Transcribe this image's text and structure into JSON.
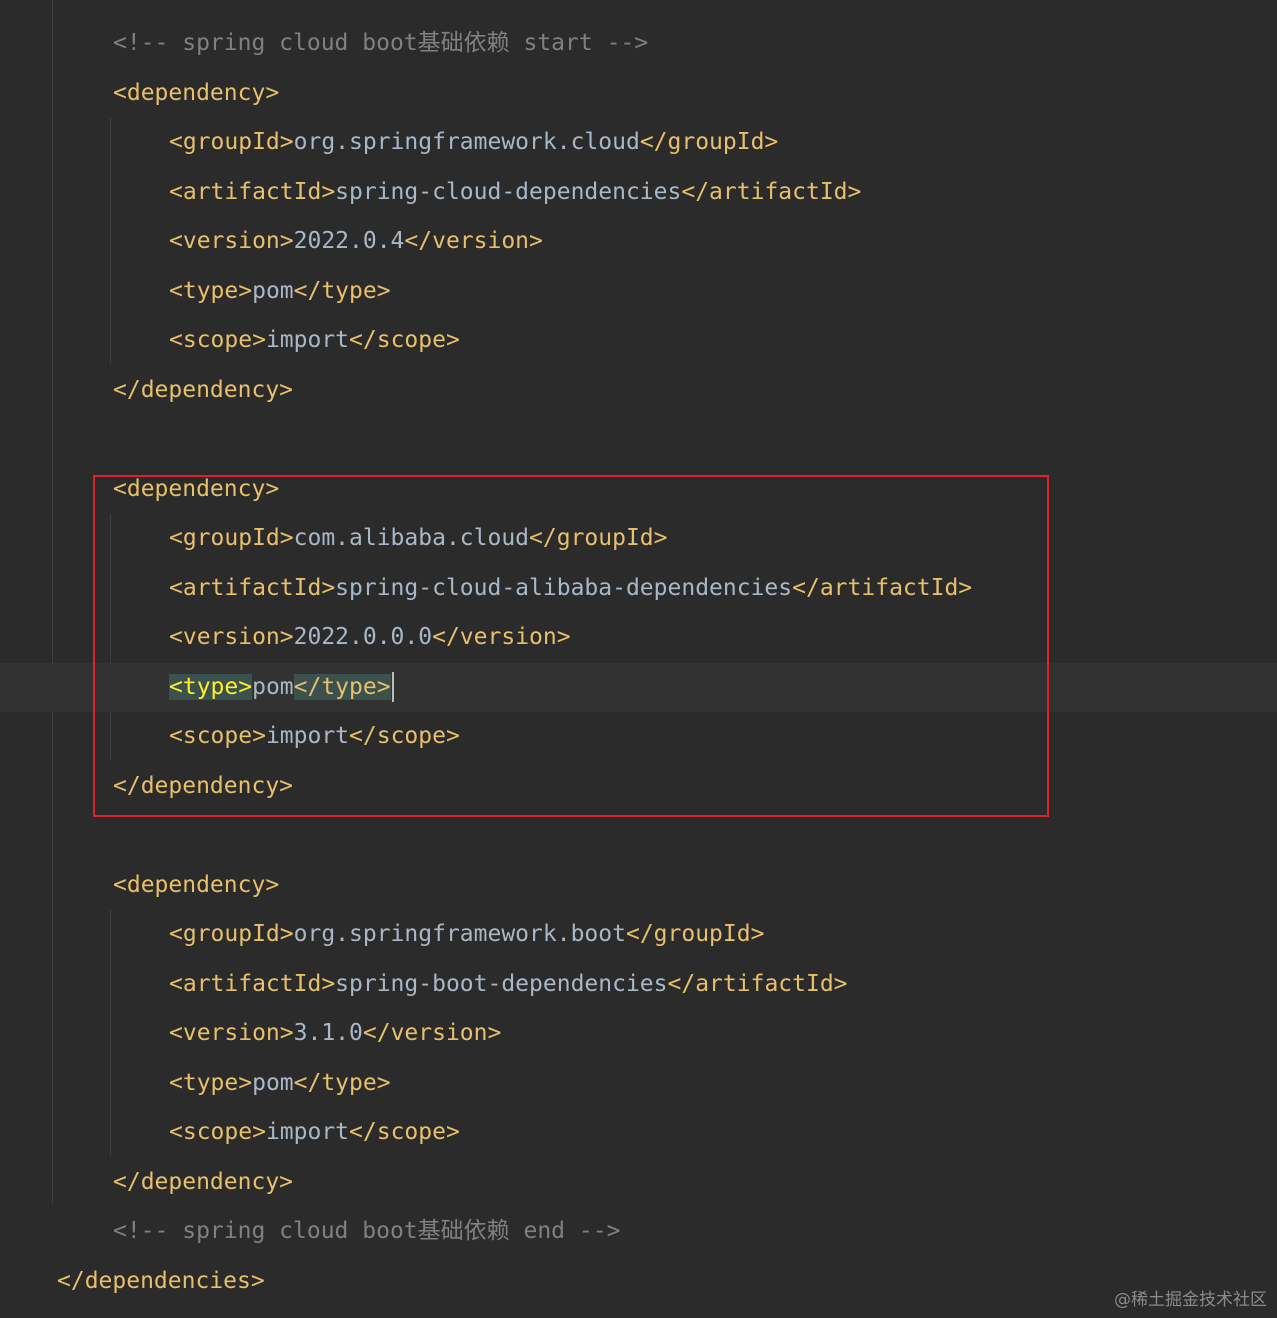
{
  "editor": {
    "lines": [
      {
        "id": "comment-start",
        "indent": 1,
        "parts": [
          {
            "t": "comment",
            "v": "<!-- spring cloud boot基础依赖 start -->"
          }
        ]
      },
      {
        "id": "dep1-open",
        "indent": 1,
        "parts": [
          {
            "t": "tag",
            "v": "<dependency>"
          }
        ]
      },
      {
        "id": "dep1-groupId",
        "indent": 2,
        "parts": [
          {
            "t": "tag",
            "v": "<groupId>"
          },
          {
            "t": "txt",
            "v": "org.springframework.cloud"
          },
          {
            "t": "tag",
            "v": "</groupId>"
          }
        ]
      },
      {
        "id": "dep1-artifactId",
        "indent": 2,
        "parts": [
          {
            "t": "tag",
            "v": "<artifactId>"
          },
          {
            "t": "txt",
            "v": "spring-cloud-dependencies"
          },
          {
            "t": "tag",
            "v": "</artifactId>"
          }
        ]
      },
      {
        "id": "dep1-version",
        "indent": 2,
        "parts": [
          {
            "t": "tag",
            "v": "<version>"
          },
          {
            "t": "txt",
            "v": "2022.0.4"
          },
          {
            "t": "tag",
            "v": "</version>"
          }
        ]
      },
      {
        "id": "dep1-type",
        "indent": 2,
        "parts": [
          {
            "t": "tag",
            "v": "<type>"
          },
          {
            "t": "txt",
            "v": "pom"
          },
          {
            "t": "tag",
            "v": "</type>"
          }
        ]
      },
      {
        "id": "dep1-scope",
        "indent": 2,
        "parts": [
          {
            "t": "tag",
            "v": "<scope>"
          },
          {
            "t": "txt",
            "v": "import"
          },
          {
            "t": "tag",
            "v": "</scope>"
          }
        ]
      },
      {
        "id": "dep1-close",
        "indent": 1,
        "parts": [
          {
            "t": "tag",
            "v": "</dependency>"
          }
        ]
      },
      {
        "id": "blank-1",
        "indent": 1,
        "parts": []
      },
      {
        "id": "dep2-open",
        "indent": 1,
        "parts": [
          {
            "t": "tag",
            "v": "<dependency>"
          }
        ]
      },
      {
        "id": "dep2-groupId",
        "indent": 2,
        "parts": [
          {
            "t": "tag",
            "v": "<groupId>"
          },
          {
            "t": "txt",
            "v": "com.alibaba.cloud"
          },
          {
            "t": "tag",
            "v": "</groupId>"
          }
        ]
      },
      {
        "id": "dep2-artifactId",
        "indent": 2,
        "parts": [
          {
            "t": "tag",
            "v": "<artifactId>"
          },
          {
            "t": "txt",
            "v": "spring-cloud-alibaba-dependencies"
          },
          {
            "t": "tag",
            "v": "</artifactId>"
          }
        ]
      },
      {
        "id": "dep2-version",
        "indent": 2,
        "parts": [
          {
            "t": "tag",
            "v": "<version>"
          },
          {
            "t": "txt",
            "v": "2022.0.0.0"
          },
          {
            "t": "tag",
            "v": "</version>"
          }
        ]
      },
      {
        "id": "dep2-type",
        "indent": 2,
        "current": true,
        "parts": [
          {
            "t": "match",
            "v": "<type>"
          },
          {
            "t": "txt",
            "v": "pom"
          },
          {
            "t": "match2",
            "v": "</type>"
          },
          {
            "t": "caret",
            "v": ""
          }
        ]
      },
      {
        "id": "dep2-scope",
        "indent": 2,
        "parts": [
          {
            "t": "tag",
            "v": "<scope>"
          },
          {
            "t": "txt",
            "v": "import"
          },
          {
            "t": "tag",
            "v": "</scope>"
          }
        ]
      },
      {
        "id": "dep2-close",
        "indent": 1,
        "parts": [
          {
            "t": "tag",
            "v": "</dependency>"
          }
        ]
      },
      {
        "id": "blank-2",
        "indent": 1,
        "parts": []
      },
      {
        "id": "dep3-open",
        "indent": 1,
        "parts": [
          {
            "t": "tag",
            "v": "<dependency>"
          }
        ]
      },
      {
        "id": "dep3-groupId",
        "indent": 2,
        "parts": [
          {
            "t": "tag",
            "v": "<groupId>"
          },
          {
            "t": "txt",
            "v": "org.springframework.boot"
          },
          {
            "t": "tag",
            "v": "</groupId>"
          }
        ]
      },
      {
        "id": "dep3-artifactId",
        "indent": 2,
        "parts": [
          {
            "t": "tag",
            "v": "<artifactId>"
          },
          {
            "t": "txt",
            "v": "spring-boot-dependencies"
          },
          {
            "t": "tag",
            "v": "</artifactId>"
          }
        ]
      },
      {
        "id": "dep3-version",
        "indent": 2,
        "parts": [
          {
            "t": "tag",
            "v": "<version>"
          },
          {
            "t": "txt",
            "v": "3.1.0"
          },
          {
            "t": "tag",
            "v": "</version>"
          }
        ]
      },
      {
        "id": "dep3-type",
        "indent": 2,
        "parts": [
          {
            "t": "tag",
            "v": "<type>"
          },
          {
            "t": "txt",
            "v": "pom"
          },
          {
            "t": "tag",
            "v": "</type>"
          }
        ]
      },
      {
        "id": "dep3-scope",
        "indent": 2,
        "parts": [
          {
            "t": "tag",
            "v": "<scope>"
          },
          {
            "t": "txt",
            "v": "import"
          },
          {
            "t": "tag",
            "v": "</scope>"
          }
        ]
      },
      {
        "id": "dep3-close",
        "indent": 1,
        "parts": [
          {
            "t": "tag",
            "v": "</dependency>"
          }
        ]
      },
      {
        "id": "comment-end",
        "indent": 1,
        "parts": [
          {
            "t": "comment",
            "v": "<!-- spring cloud boot基础依赖 end -->"
          }
        ]
      },
      {
        "id": "dependencies-close",
        "indent": 0,
        "parts": [
          {
            "t": "tag",
            "v": "</dependencies>"
          }
        ]
      }
    ]
  },
  "annotation": {
    "highlight_color": "#e0202a"
  },
  "watermark": {
    "text": "@稀土掘金技术社区"
  }
}
